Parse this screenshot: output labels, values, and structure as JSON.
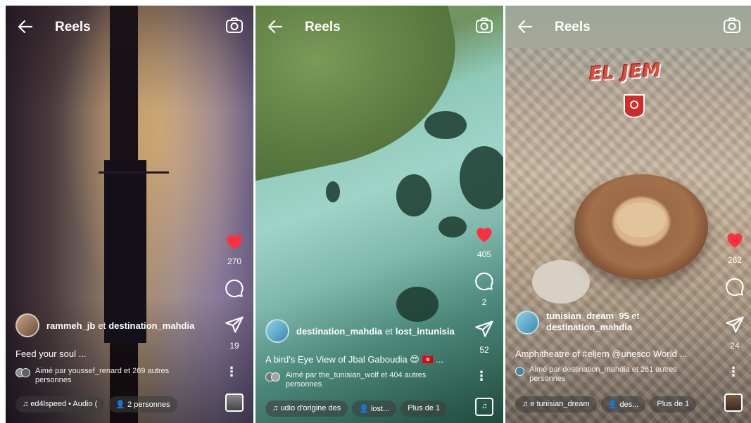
{
  "panels": [
    {
      "title": "Reels",
      "likes": "270",
      "shares": "19",
      "user_main": "rammeh_jb",
      "user_join": "et",
      "user_second": "destination_mahdia",
      "caption": "Feed your soul ...",
      "liked_by": "Aimé par youssef_renard et 269 autres personnes",
      "chips": [
        "ed4lspeed • Audio (",
        "2 personnes"
      ]
    },
    {
      "title": "Reels",
      "likes": "405",
      "comments": "2",
      "shares": "52",
      "user_main": "destination_mahdia",
      "user_join": "et",
      "user_second": "lost_intunisia",
      "caption": "A bird's Eye View of Jbal Gaboudia 😍 🇹🇳 ...",
      "liked_by": "Aimé par the_tunisian_wolf et 404 autres personnes",
      "chips": [
        "udio d'origine   des",
        "lost...",
        "Plus de 1"
      ]
    },
    {
      "title": "Reels",
      "likes": "262",
      "shares": "24",
      "banner": "EL JEM",
      "user_main": "tunisian_dream_95",
      "user_join": "et",
      "user_second": "destination_mahdia",
      "caption": "Amphitheatre of #eljem @unesco World ...",
      "liked_by": "Aimé par destination_mahdia et 261 autres personnes",
      "chips": [
        "e   tunisian_dream",
        "des...",
        "Plus de 1"
      ]
    }
  ],
  "colors": {
    "like": "#ff3040",
    "brand_avatar": "#3a8ab0"
  },
  "icons": [
    "back-arrow-icon",
    "camera-icon",
    "heart-icon",
    "comment-icon",
    "send-icon",
    "more-icon",
    "music-note-icon",
    "person-icon"
  ]
}
